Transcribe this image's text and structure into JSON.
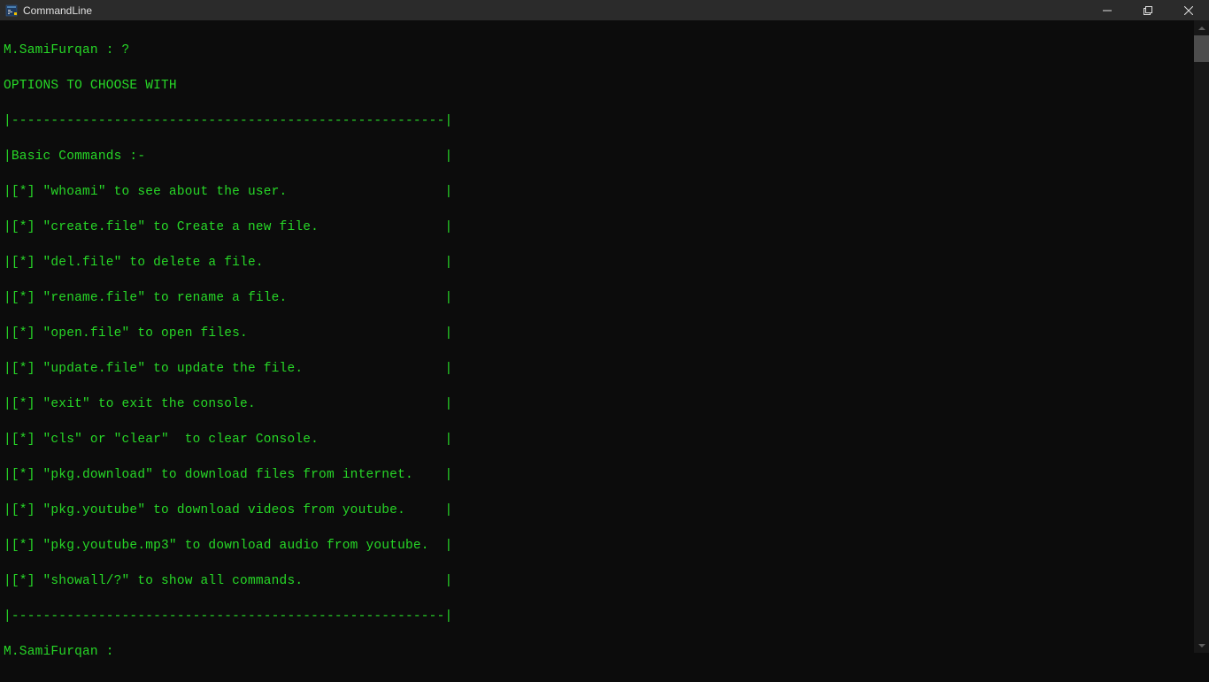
{
  "window": {
    "title": "CommandLine"
  },
  "terminal": {
    "prompt_line": "M.SamiFurqan : ?",
    "header": "OPTIONS TO CHOOSE WITH",
    "border_top": "|-------------------------------------------------------|",
    "section_title": "|Basic Commands :-                                      |",
    "commands": [
      "|[*] \"whoami\" to see about the user.                    |",
      "|[*] \"create.file\" to Create a new file.                |",
      "|[*] \"del.file\" to delete a file.                       |",
      "|[*] \"rename.file\" to rename a file.                    |",
      "|[*] \"open.file\" to open files.                         |",
      "|[*] \"update.file\" to update the file.                  |",
      "|[*] \"exit\" to exit the console.                        |",
      "|[*] \"cls\" or \"clear\"  to clear Console.                |",
      "|[*] \"pkg.download\" to download files from internet.    |",
      "|[*] \"pkg.youtube\" to download videos from youtube.     |",
      "|[*] \"pkg.youtube.mp3\" to download audio from youtube.  |",
      "|[*] \"showall/?\" to show all commands.                  |"
    ],
    "border_bottom": "|-------------------------------------------------------|",
    "prompt_new": "M.SamiFurqan : "
  }
}
